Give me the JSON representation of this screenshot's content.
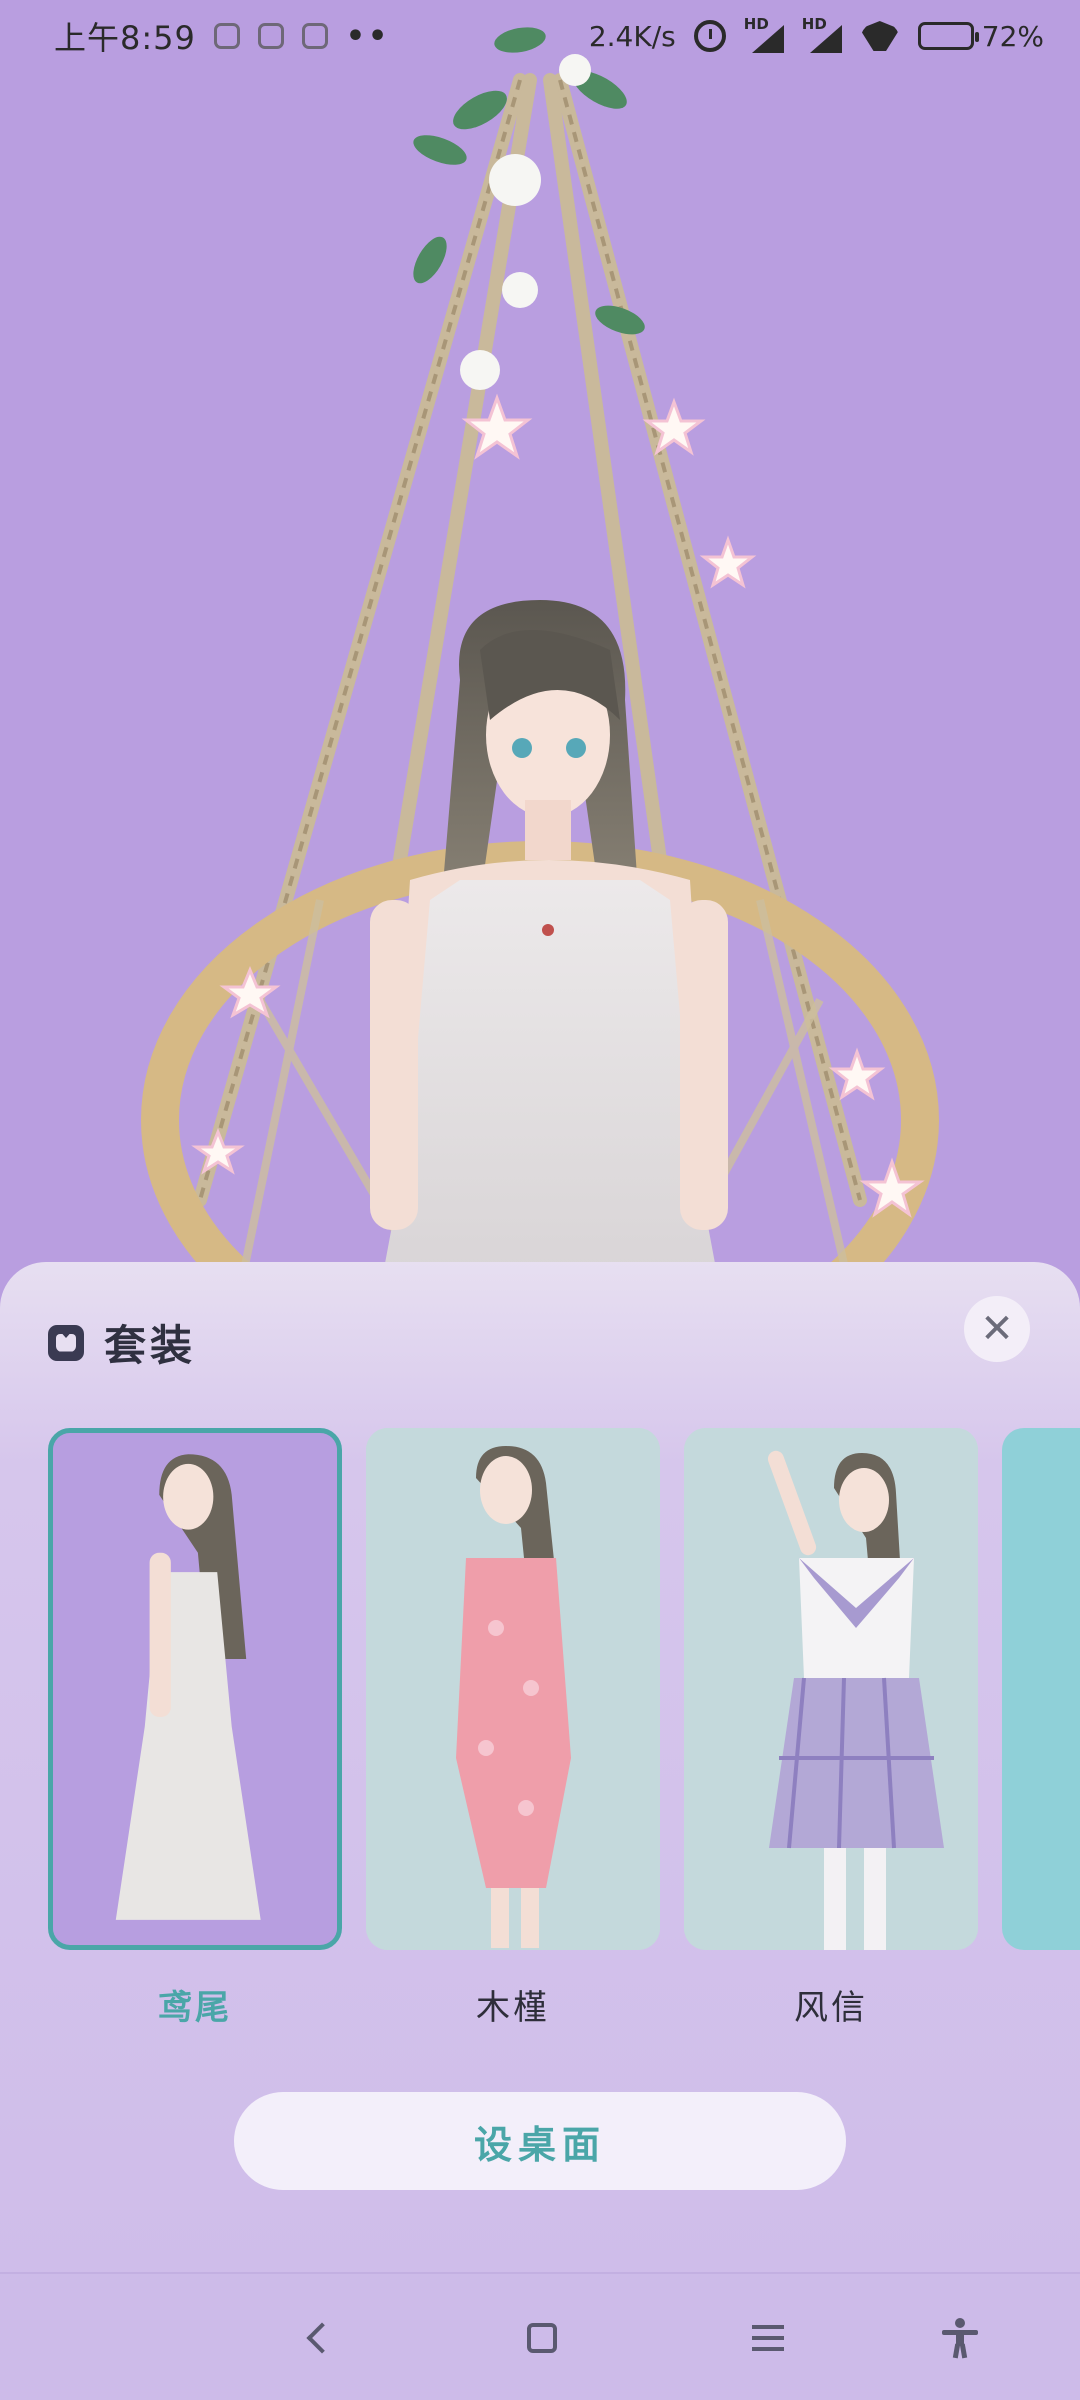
{
  "status_bar": {
    "time": "上午8:59",
    "more_dots": "••",
    "net_speed": "2.4K/s",
    "battery_percent": "72%",
    "battery_level": 0.72,
    "signal_label_1": "HD",
    "signal_label_2": "HD"
  },
  "sheet": {
    "title": "套装",
    "close_symbol": "✕"
  },
  "outfits": [
    {
      "label": "鸢尾",
      "selected": true
    },
    {
      "label": "木槿",
      "selected": false
    },
    {
      "label": "风信",
      "selected": false
    }
  ],
  "set_button": {
    "label": "设桌面"
  },
  "colors": {
    "accent": "#4aa6a8",
    "background": "#b99ee0",
    "card_bg_selected": "#b79ee0",
    "card_bg": "#c4d9dc",
    "card_bg_partial": "#8fd0d8"
  },
  "icons": {
    "outfit": "outfit-icon",
    "close": "close-icon",
    "back": "back-icon",
    "home": "home-icon",
    "recents": "menu-icon",
    "accessibility": "accessibility-icon"
  }
}
